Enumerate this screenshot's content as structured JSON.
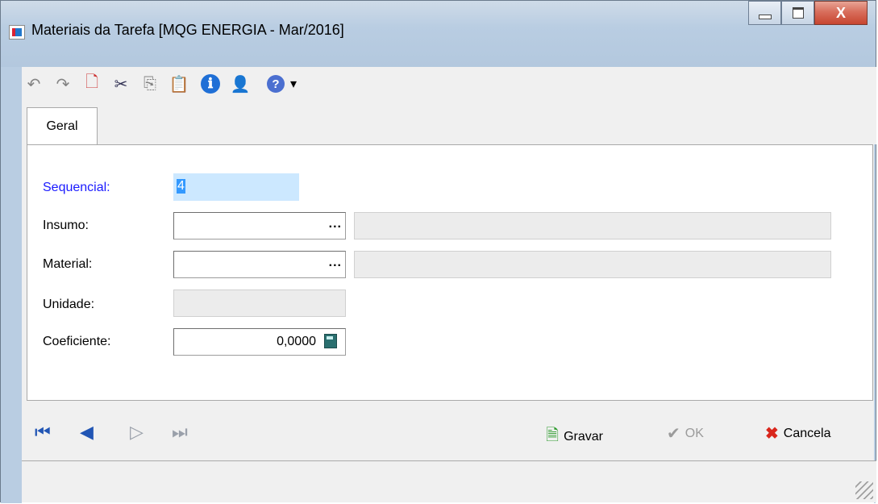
{
  "window": {
    "title": "Materiais da Tarefa [MQG ENERGIA - Mar/2016]",
    "close_glyph": "X"
  },
  "toolbar": {
    "buttons": [
      {
        "name": "undo-icon",
        "glyph": "↶",
        "enabled": false
      },
      {
        "name": "redo-icon",
        "glyph": "↷",
        "enabled": false
      },
      {
        "name": "new-document-icon",
        "glyph": "🗋",
        "enabled": true
      },
      {
        "name": "cut-icon",
        "glyph": "✂",
        "enabled": true
      },
      {
        "name": "copy-icon",
        "glyph": "⎘",
        "enabled": false
      },
      {
        "name": "paste-icon",
        "glyph": "📋",
        "enabled": true
      },
      {
        "name": "info-icon",
        "glyph": "ℹ",
        "enabled": true
      },
      {
        "name": "user-icon",
        "glyph": "👤",
        "enabled": true
      },
      {
        "name": "help-icon",
        "glyph": "?",
        "enabled": true
      },
      {
        "name": "dropdown-arrow-icon",
        "glyph": "▾",
        "enabled": true
      }
    ]
  },
  "tabs": [
    {
      "label": "Geral"
    }
  ],
  "form": {
    "sequencial": {
      "label": "Sequencial:",
      "value": "4"
    },
    "insumo": {
      "label": "Insumo:",
      "value": "",
      "description": ""
    },
    "material": {
      "label": "Material:",
      "value": "",
      "description": ""
    },
    "unidade": {
      "label": "Unidade:",
      "value": ""
    },
    "coeficiente": {
      "label": "Coeficiente:",
      "value": "0,0000"
    },
    "lookup_glyph": "..."
  },
  "navigation": {
    "first": "⏮",
    "prev": "◀",
    "next": "▷",
    "last": "⏭"
  },
  "actions": {
    "gravar": "Gravar",
    "ok": "OK",
    "cancela": "Cancela"
  },
  "colors": {
    "label_required": "#1a1aff",
    "selection": "#3399ff",
    "cancel_icon": "#d9261c"
  }
}
